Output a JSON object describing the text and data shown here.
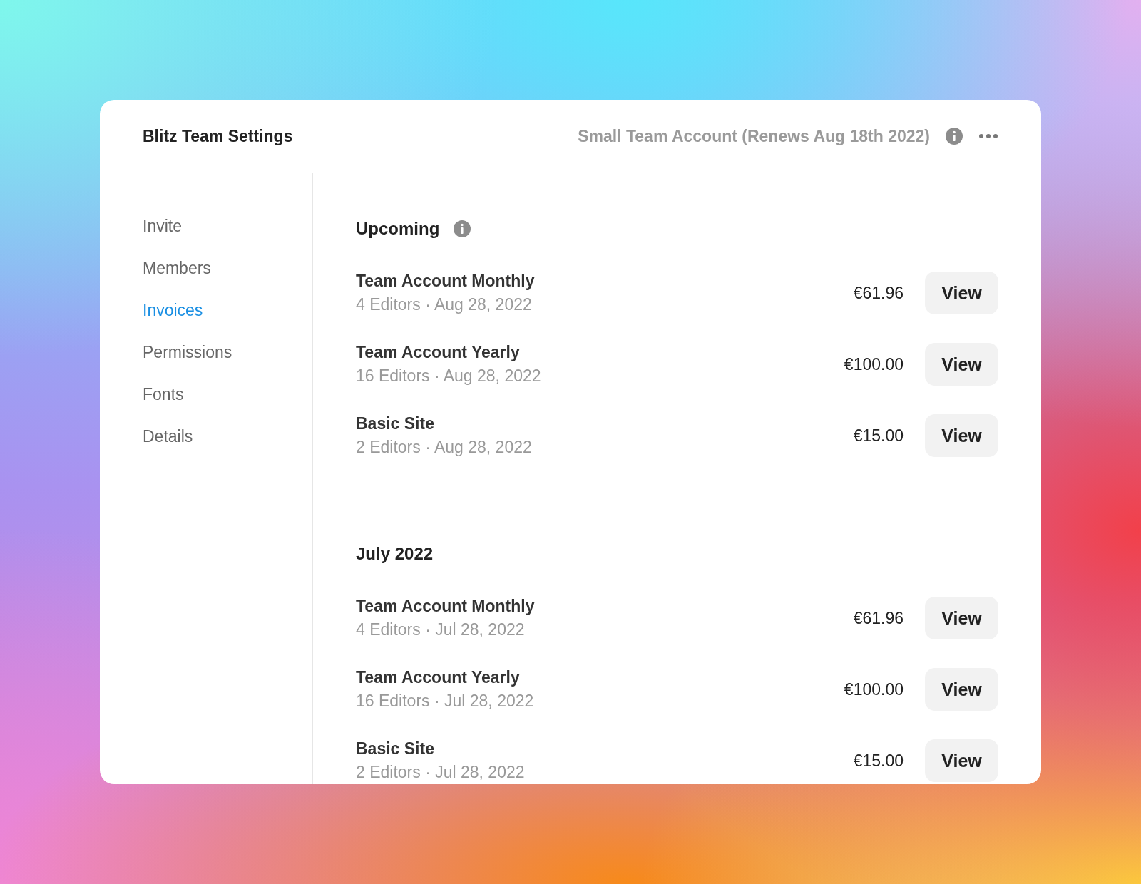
{
  "header": {
    "title": "Blitz Team Settings",
    "plan": "Small Team Account (Renews Aug 18th 2022)"
  },
  "sidebar": {
    "items": [
      {
        "label": "Invite",
        "selected": false
      },
      {
        "label": "Members",
        "selected": false
      },
      {
        "label": "Invoices",
        "selected": true
      },
      {
        "label": "Permissions",
        "selected": false
      },
      {
        "label": "Fonts",
        "selected": false
      },
      {
        "label": "Details",
        "selected": false
      }
    ]
  },
  "sections": [
    {
      "title": "Upcoming",
      "info_icon": true,
      "invoices": [
        {
          "name": "Team Account Monthly",
          "subtitle": "4 Editors · Aug 28, 2022",
          "price": "€61.96",
          "button": "View"
        },
        {
          "name": "Team Account Yearly",
          "subtitle": "16 Editors · Aug 28, 2022",
          "price": "€100.00",
          "button": "View"
        },
        {
          "name": "Basic Site",
          "subtitle": "2 Editors · Aug 28, 2022",
          "price": "€15.00",
          "button": "View"
        }
      ]
    },
    {
      "title": "July 2022",
      "info_icon": false,
      "invoices": [
        {
          "name": "Team Account Monthly",
          "subtitle": "4 Editors · Jul 28, 2022",
          "price": "€61.96",
          "button": "View"
        },
        {
          "name": "Team Account Yearly",
          "subtitle": "16 Editors · Jul 28, 2022",
          "price": "€100.00",
          "button": "View"
        },
        {
          "name": "Basic Site",
          "subtitle": "2 Editors · Jul 28, 2022",
          "price": "€15.00",
          "button": "View"
        }
      ]
    }
  ]
}
